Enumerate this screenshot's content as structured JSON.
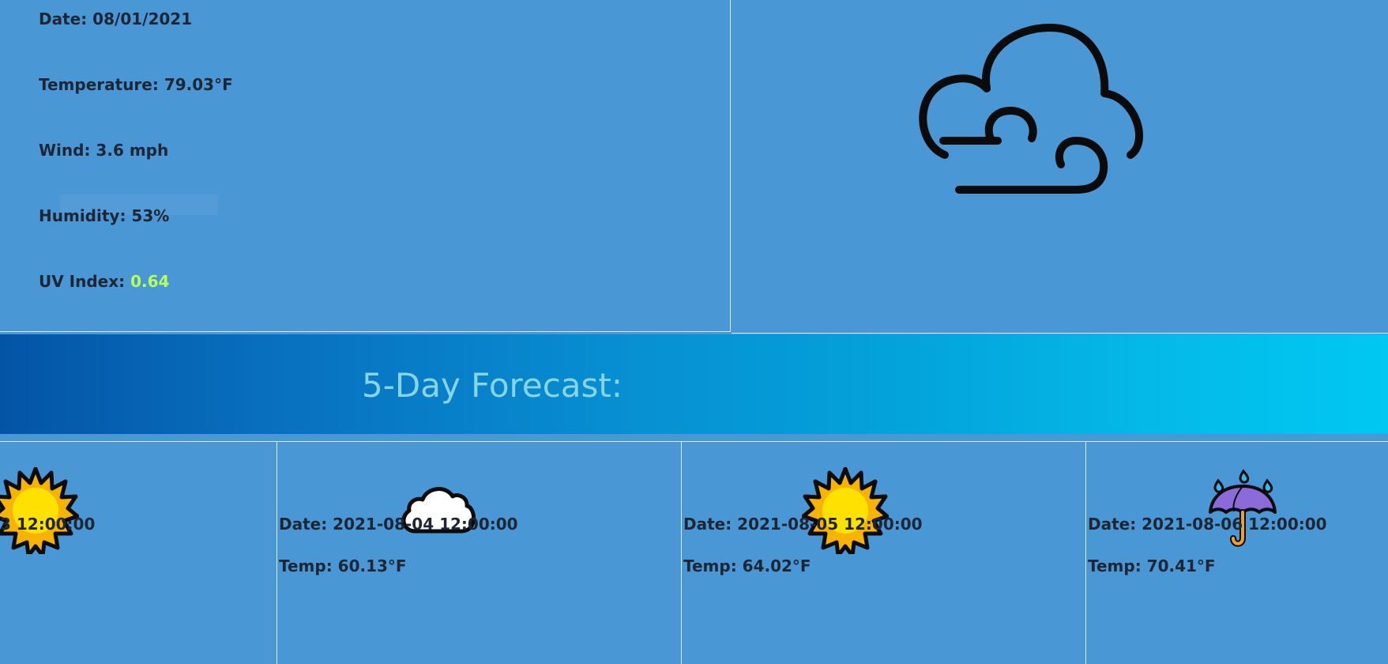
{
  "current": {
    "date": "Date: 08/01/2021",
    "temperature": "Temperature: 79.03°F",
    "wind": "Wind: 3.6 mph",
    "humidity": "Humidity: 53%",
    "uv_label": "UV Index: ",
    "uv_value": "0.64",
    "uv_color": "#b7ff5a",
    "icon": "cloud-wind-icon"
  },
  "forecast": {
    "title": "5-Day Forecast:",
    "cards": [
      {
        "icon": "sun-icon",
        "date": "3 12:00:00",
        "temp": ""
      },
      {
        "icon": "cloud-icon",
        "date": "Date: 2021-08-04 12:00:00",
        "temp": "Temp: 60.13°F"
      },
      {
        "icon": "sun-icon",
        "date": "Date: 2021-08-05 12:00:00",
        "temp": "Temp: 64.02°F"
      },
      {
        "icon": "umbrella-rain-icon",
        "date": "Date: 2021-08-06 12:00:00",
        "temp": "Temp: 70.41°F"
      }
    ]
  },
  "colors": {
    "background": "#4a97d6",
    "text": "#1f2633",
    "forecast_title": "#86d4e4"
  }
}
